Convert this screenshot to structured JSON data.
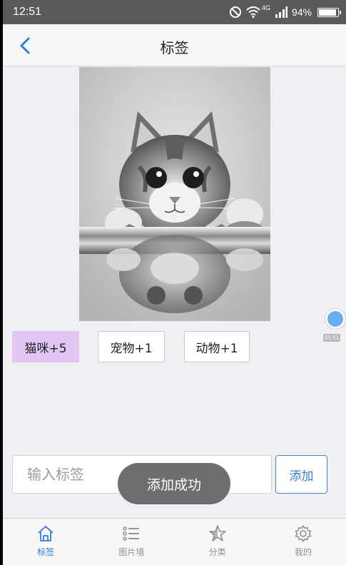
{
  "status_bar": {
    "time": "12:51",
    "network": "4G",
    "battery": "94%",
    "battery_level": 0.94,
    "icons": [
      "do-not-disturb-icon",
      "wifi-icon",
      "signal-icon",
      "battery-icon"
    ]
  },
  "nav": {
    "title": "标签",
    "back_icon": "back-chevron-icon"
  },
  "photo": {
    "subject": "cat-photo"
  },
  "tags": [
    {
      "label": "猫咪+5",
      "selected": true
    },
    {
      "label": "宠物+1",
      "selected": false
    },
    {
      "label": "动物+1",
      "selected": false
    }
  ],
  "floating_timer": {
    "time": "01:51"
  },
  "input": {
    "placeholder": "输入标签",
    "value": ""
  },
  "add_button": {
    "label": "添加"
  },
  "toast": {
    "text": "添加成功"
  },
  "tab_bar": {
    "items": [
      {
        "label": "标签",
        "icon": "home-icon",
        "active": true
      },
      {
        "label": "图片墙",
        "icon": "list-icon",
        "active": false
      },
      {
        "label": "分类",
        "icon": "star-icon",
        "active": false
      },
      {
        "label": "我的",
        "icon": "gear-icon",
        "active": false
      }
    ]
  },
  "colors": {
    "accent": "#2f7fd3",
    "selected_tag": "#e0c7f3",
    "background": "#efeff4"
  }
}
